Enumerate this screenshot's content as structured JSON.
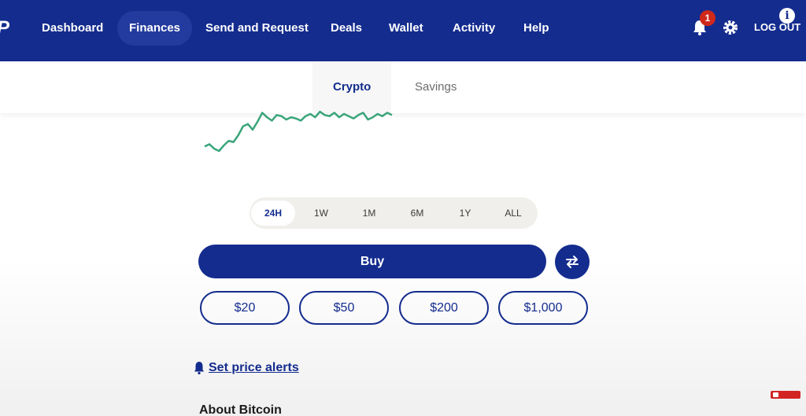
{
  "nav": {
    "items": [
      {
        "label": "Dashboard"
      },
      {
        "label": "Finances"
      },
      {
        "label": "Send and Request"
      },
      {
        "label": "Deals"
      },
      {
        "label": "Wallet"
      },
      {
        "label": "Activity"
      },
      {
        "label": "Help"
      }
    ],
    "notification_count": "1",
    "logout_label": "LOG OUT"
  },
  "subnav": {
    "tabs": [
      {
        "label": "Crypto"
      },
      {
        "label": "Savings"
      }
    ]
  },
  "chart": {
    "line_color": "#3aa57a",
    "values": [
      40,
      42,
      38,
      36,
      41,
      45,
      44,
      50,
      58,
      60,
      55,
      62,
      70,
      66,
      63,
      68,
      67,
      64,
      66,
      65,
      63,
      67,
      69,
      66,
      71,
      68,
      67,
      70,
      66,
      69,
      67,
      65,
      68,
      70,
      64,
      66,
      69,
      67,
      70,
      68
    ]
  },
  "ranges": [
    "24H",
    "1W",
    "1M",
    "6M",
    "1Y",
    "ALL"
  ],
  "buy_label": "Buy",
  "amounts": [
    "$20",
    "$50",
    "$200",
    "$1,000"
  ],
  "alert_label": "Set price alerts",
  "about_heading": "About Bitcoin",
  "colors": {
    "brand": "#142c8e",
    "accent_green": "#3aa57a",
    "badge_red": "#d0281b"
  }
}
